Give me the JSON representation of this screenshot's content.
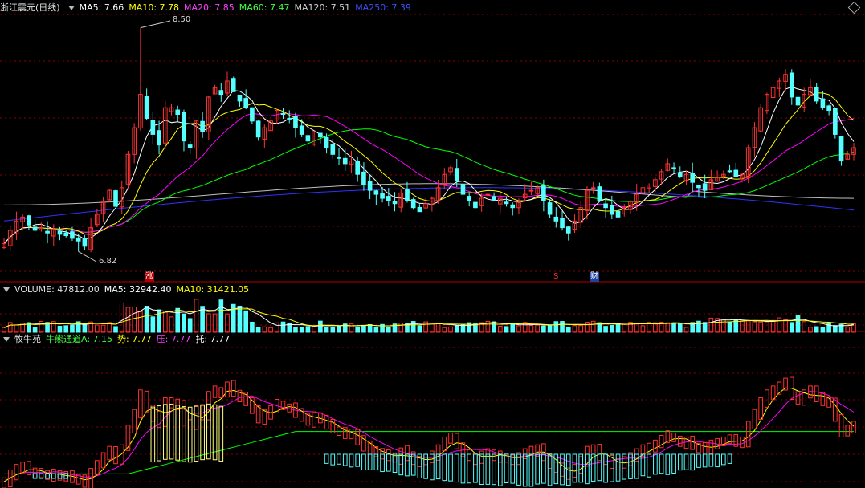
{
  "main_header": {
    "title": "浙江震元(日线)",
    "ma5": "MA5: 7.66",
    "ma10": "MA10: 7.78",
    "ma20": "MA20: 7.85",
    "ma60": "MA60: 7.47",
    "ma120": "MA120: 7.51",
    "ma250": "MA250: 7.39"
  },
  "volume_header": {
    "title": "VOLUME: 47812.00",
    "ma5": "MA5: 32942.40",
    "ma10": "MA10: 31421.05"
  },
  "indicator_header": {
    "title": "牧牛苑",
    "channel": "牛熊通道A: 7.15",
    "trend": "势: 7.77",
    "press": "压: 7.77",
    "support": "托: 7.77"
  },
  "markers": {
    "high": "8.50",
    "low": "6.82",
    "zhang": "涨",
    "s": "S",
    "cai": "财"
  },
  "colors": {
    "up": "#ff3232",
    "down": "#54ffff",
    "ma5": "#ffffff",
    "ma10": "#ffff00",
    "ma20": "#ff00ff",
    "ma60": "#00ff00",
    "ma120": "#c0c0c0",
    "ma250": "#3030ff",
    "grid": "#8b0000"
  },
  "chart_data": {
    "type": "candlestick",
    "price_range": [
      6.6,
      8.6
    ],
    "period_high": 8.5,
    "period_low": 6.82,
    "closes": [
      6.88,
      6.98,
      7.05,
      7.08,
      7.02,
      6.98,
      7.0,
      6.96,
      6.99,
      6.95,
      6.94,
      6.92,
      6.9,
      6.86,
      7.0,
      7.1,
      7.2,
      7.28,
      7.16,
      7.3,
      7.55,
      7.75,
      8.0,
      7.82,
      7.7,
      7.62,
      7.9,
      7.9,
      7.85,
      7.65,
      7.6,
      7.8,
      7.72,
      7.98,
      8.05,
      8.0,
      8.1,
      8.02,
      7.95,
      7.9,
      7.8,
      7.68,
      7.75,
      7.8,
      7.88,
      7.85,
      7.82,
      7.75,
      7.7,
      7.65,
      7.72,
      7.68,
      7.6,
      7.55,
      7.52,
      7.48,
      7.5,
      7.4,
      7.32,
      7.28,
      7.25,
      7.22,
      7.2,
      7.18,
      7.26,
      7.2,
      7.15,
      7.12,
      7.18,
      7.22,
      7.3,
      7.4,
      7.45,
      7.35,
      7.25,
      7.2,
      7.15,
      7.22,
      7.25,
      7.2,
      7.22,
      7.18,
      7.15,
      7.2,
      7.25,
      7.28,
      7.3,
      7.2,
      7.1,
      7.05,
      7.0,
      6.96,
      7.05,
      7.15,
      7.28,
      7.3,
      7.2,
      7.15,
      7.1,
      7.08,
      7.15,
      7.2,
      7.25,
      7.3,
      7.32,
      7.36,
      7.42,
      7.48,
      7.44,
      7.38,
      7.4,
      7.34,
      7.3,
      7.28,
      7.36,
      7.38,
      7.4,
      7.42,
      7.38,
      7.4,
      7.6,
      7.75,
      7.9,
      8.0,
      8.05,
      8.1,
      8.15,
      7.98,
      7.92,
      8.0,
      8.05,
      7.95,
      7.9,
      7.88,
      7.7,
      7.5,
      7.55,
      7.6
    ],
    "volume_range": [
      0,
      60000
    ],
    "indicator_range": [
      6.8,
      8.6
    ]
  }
}
